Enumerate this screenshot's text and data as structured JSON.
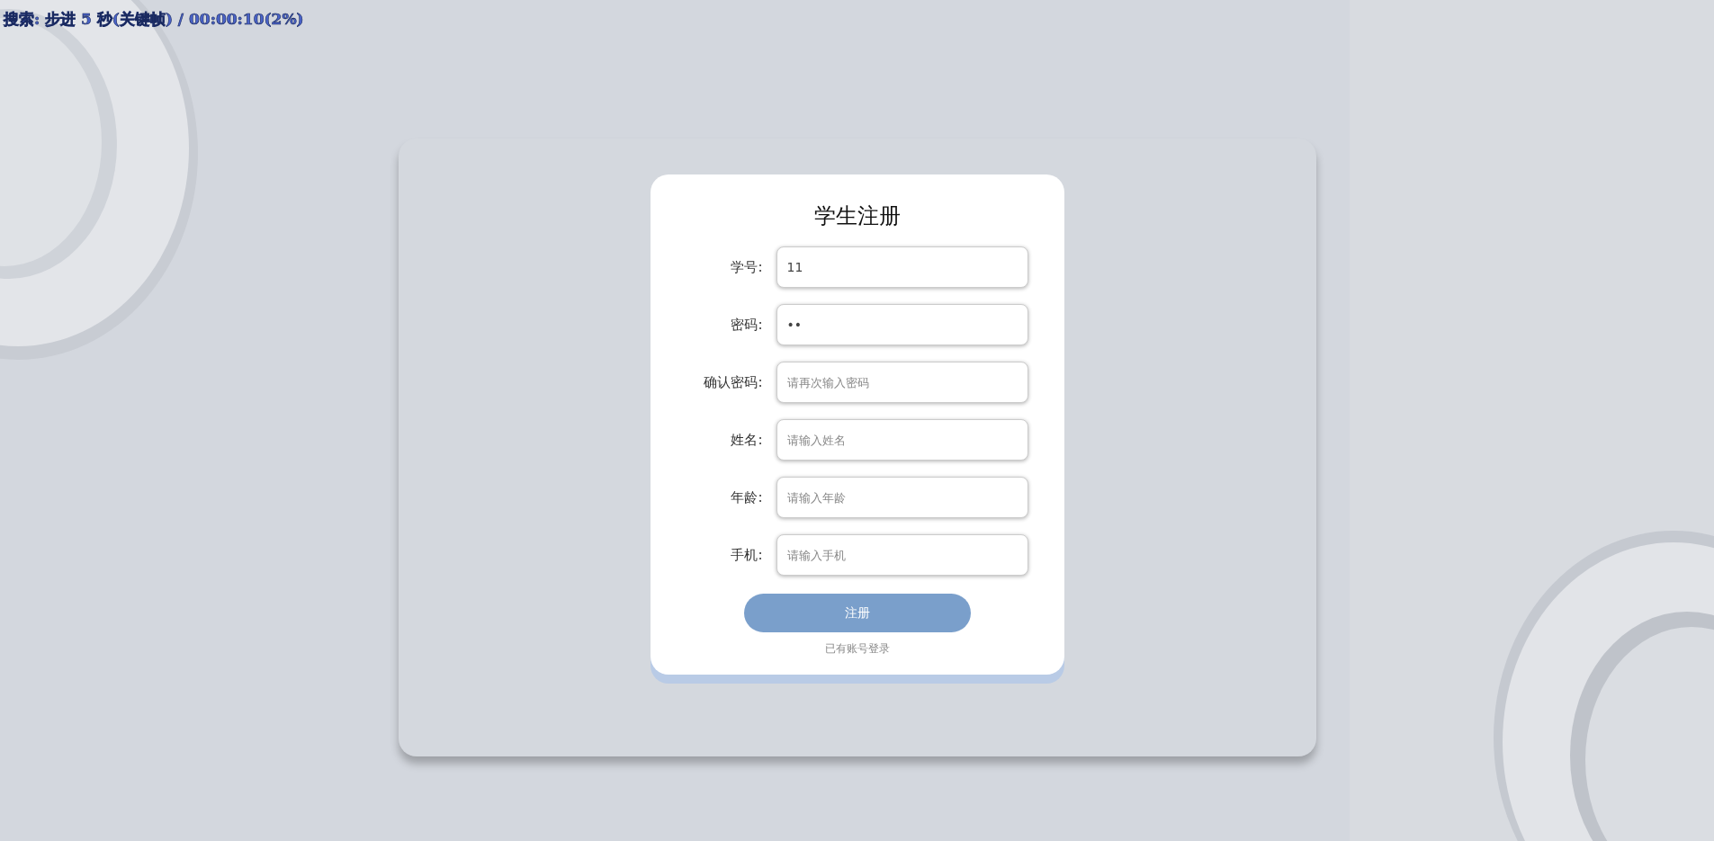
{
  "overlay": {
    "text": "搜索: 步进 5 秒(关键帧) / 00:00:10(2%)"
  },
  "form": {
    "title": "学生注册",
    "fields": [
      {
        "label": "学号:",
        "value": "11"
      },
      {
        "label": "密码:",
        "value": "••"
      },
      {
        "label": "确认密码:",
        "placeholder": "请再次输入密码"
      },
      {
        "label": "姓名:",
        "placeholder": "请输入姓名"
      },
      {
        "label": "年龄:",
        "placeholder": "请输入年龄"
      },
      {
        "label": "手机:",
        "placeholder": "请输入手机"
      }
    ],
    "submit": "注册",
    "login_link": "已有账号登录"
  }
}
